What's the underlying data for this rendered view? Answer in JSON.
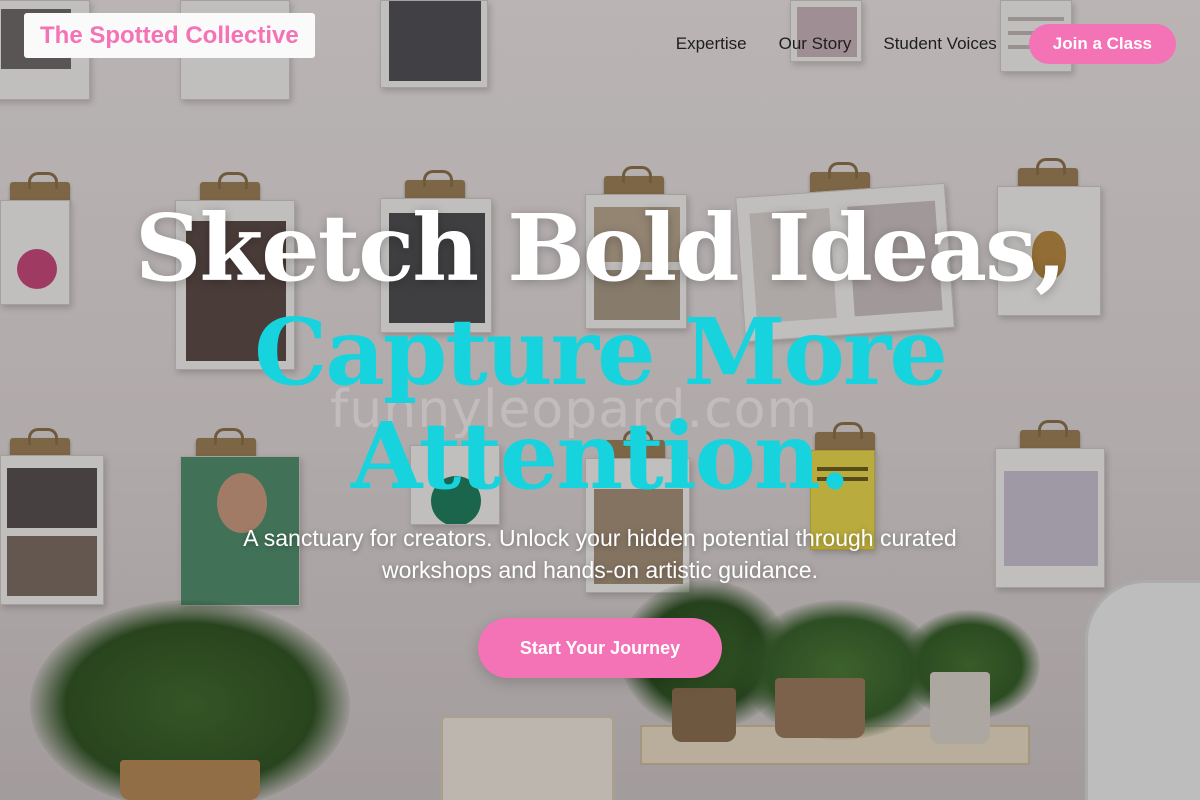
{
  "brand": {
    "name": "The Spotted Collective"
  },
  "nav": {
    "links": [
      "Expertise",
      "Our Story",
      "Student Voices"
    ],
    "cta": "Join a Class"
  },
  "hero": {
    "line1": "Sketch Bold Ideas,",
    "line2": "Capture More",
    "line3": "Attention.",
    "subtitle": "A sanctuary for creators. Unlock your hidden potential through curated workshops and hands-on artistic guidance.",
    "cta": "Start Your Journey"
  },
  "watermark": "funnyleopard.com",
  "colors": {
    "accent_pink": "#f472b6",
    "accent_cyan": "#17d3dd",
    "text_dark": "#1e1e1e"
  }
}
